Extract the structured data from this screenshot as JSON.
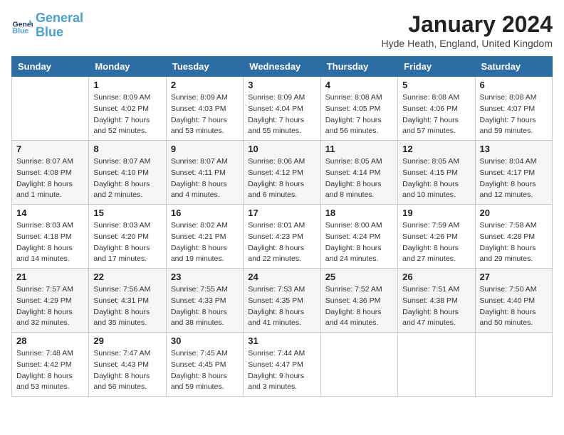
{
  "header": {
    "logo_line1": "General",
    "logo_line2": "Blue",
    "title": "January 2024",
    "location": "Hyde Heath, England, United Kingdom"
  },
  "weekdays": [
    "Sunday",
    "Monday",
    "Tuesday",
    "Wednesday",
    "Thursday",
    "Friday",
    "Saturday"
  ],
  "weeks": [
    [
      {
        "day": "",
        "info": ""
      },
      {
        "day": "1",
        "info": "Sunrise: 8:09 AM\nSunset: 4:02 PM\nDaylight: 7 hours\nand 52 minutes."
      },
      {
        "day": "2",
        "info": "Sunrise: 8:09 AM\nSunset: 4:03 PM\nDaylight: 7 hours\nand 53 minutes."
      },
      {
        "day": "3",
        "info": "Sunrise: 8:09 AM\nSunset: 4:04 PM\nDaylight: 7 hours\nand 55 minutes."
      },
      {
        "day": "4",
        "info": "Sunrise: 8:08 AM\nSunset: 4:05 PM\nDaylight: 7 hours\nand 56 minutes."
      },
      {
        "day": "5",
        "info": "Sunrise: 8:08 AM\nSunset: 4:06 PM\nDaylight: 7 hours\nand 57 minutes."
      },
      {
        "day": "6",
        "info": "Sunrise: 8:08 AM\nSunset: 4:07 PM\nDaylight: 7 hours\nand 59 minutes."
      }
    ],
    [
      {
        "day": "7",
        "info": "Sunrise: 8:07 AM\nSunset: 4:08 PM\nDaylight: 8 hours\nand 1 minute."
      },
      {
        "day": "8",
        "info": "Sunrise: 8:07 AM\nSunset: 4:10 PM\nDaylight: 8 hours\nand 2 minutes."
      },
      {
        "day": "9",
        "info": "Sunrise: 8:07 AM\nSunset: 4:11 PM\nDaylight: 8 hours\nand 4 minutes."
      },
      {
        "day": "10",
        "info": "Sunrise: 8:06 AM\nSunset: 4:12 PM\nDaylight: 8 hours\nand 6 minutes."
      },
      {
        "day": "11",
        "info": "Sunrise: 8:05 AM\nSunset: 4:14 PM\nDaylight: 8 hours\nand 8 minutes."
      },
      {
        "day": "12",
        "info": "Sunrise: 8:05 AM\nSunset: 4:15 PM\nDaylight: 8 hours\nand 10 minutes."
      },
      {
        "day": "13",
        "info": "Sunrise: 8:04 AM\nSunset: 4:17 PM\nDaylight: 8 hours\nand 12 minutes."
      }
    ],
    [
      {
        "day": "14",
        "info": "Sunrise: 8:03 AM\nSunset: 4:18 PM\nDaylight: 8 hours\nand 14 minutes."
      },
      {
        "day": "15",
        "info": "Sunrise: 8:03 AM\nSunset: 4:20 PM\nDaylight: 8 hours\nand 17 minutes."
      },
      {
        "day": "16",
        "info": "Sunrise: 8:02 AM\nSunset: 4:21 PM\nDaylight: 8 hours\nand 19 minutes."
      },
      {
        "day": "17",
        "info": "Sunrise: 8:01 AM\nSunset: 4:23 PM\nDaylight: 8 hours\nand 22 minutes."
      },
      {
        "day": "18",
        "info": "Sunrise: 8:00 AM\nSunset: 4:24 PM\nDaylight: 8 hours\nand 24 minutes."
      },
      {
        "day": "19",
        "info": "Sunrise: 7:59 AM\nSunset: 4:26 PM\nDaylight: 8 hours\nand 27 minutes."
      },
      {
        "day": "20",
        "info": "Sunrise: 7:58 AM\nSunset: 4:28 PM\nDaylight: 8 hours\nand 29 minutes."
      }
    ],
    [
      {
        "day": "21",
        "info": "Sunrise: 7:57 AM\nSunset: 4:29 PM\nDaylight: 8 hours\nand 32 minutes."
      },
      {
        "day": "22",
        "info": "Sunrise: 7:56 AM\nSunset: 4:31 PM\nDaylight: 8 hours\nand 35 minutes."
      },
      {
        "day": "23",
        "info": "Sunrise: 7:55 AM\nSunset: 4:33 PM\nDaylight: 8 hours\nand 38 minutes."
      },
      {
        "day": "24",
        "info": "Sunrise: 7:53 AM\nSunset: 4:35 PM\nDaylight: 8 hours\nand 41 minutes."
      },
      {
        "day": "25",
        "info": "Sunrise: 7:52 AM\nSunset: 4:36 PM\nDaylight: 8 hours\nand 44 minutes."
      },
      {
        "day": "26",
        "info": "Sunrise: 7:51 AM\nSunset: 4:38 PM\nDaylight: 8 hours\nand 47 minutes."
      },
      {
        "day": "27",
        "info": "Sunrise: 7:50 AM\nSunset: 4:40 PM\nDaylight: 8 hours\nand 50 minutes."
      }
    ],
    [
      {
        "day": "28",
        "info": "Sunrise: 7:48 AM\nSunset: 4:42 PM\nDaylight: 8 hours\nand 53 minutes."
      },
      {
        "day": "29",
        "info": "Sunrise: 7:47 AM\nSunset: 4:43 PM\nDaylight: 8 hours\nand 56 minutes."
      },
      {
        "day": "30",
        "info": "Sunrise: 7:45 AM\nSunset: 4:45 PM\nDaylight: 8 hours\nand 59 minutes."
      },
      {
        "day": "31",
        "info": "Sunrise: 7:44 AM\nSunset: 4:47 PM\nDaylight: 9 hours\nand 3 minutes."
      },
      {
        "day": "",
        "info": ""
      },
      {
        "day": "",
        "info": ""
      },
      {
        "day": "",
        "info": ""
      }
    ]
  ]
}
